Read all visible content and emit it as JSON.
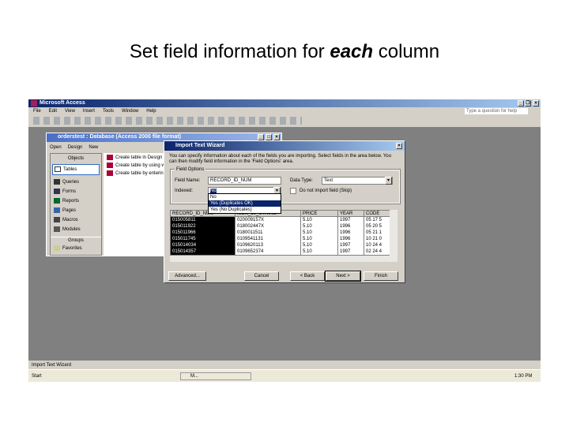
{
  "slide": {
    "title_pre": "Set field information for ",
    "title_em": "each",
    "title_post": " column"
  },
  "access": {
    "title": "Microsoft Access",
    "menu": [
      "File",
      "Edit",
      "View",
      "Insert",
      "Tools",
      "Window",
      "Help"
    ],
    "help_placeholder": "Type a question for help",
    "status": "Import Text Wizard"
  },
  "dbwin": {
    "title": "orderstest : Database (Access 2000 file format)",
    "toolbar": [
      "Open",
      "Design",
      "New"
    ],
    "objects_header": "Objects",
    "objects": [
      "Tables",
      "Queries",
      "Forms",
      "Reports",
      "Pages",
      "Macros",
      "Modules"
    ],
    "groups_header": "Groups",
    "groups": [
      "Favorites"
    ],
    "items": [
      "Create table in Design view",
      "Create table by using wizard",
      "Create table by entering data"
    ]
  },
  "wizard": {
    "title": "Import Text Wizard",
    "intro": "You can specify information about each of the fields you are importing. Select fields in the area below. You can then modify field information in the 'Field Options' area.",
    "group": "Field Options",
    "field_name_label": "Field Name:",
    "field_name": "RECORD_ID_NUM",
    "data_type_label": "Data Type:",
    "data_type": "Text",
    "indexed_label": "Indexed:",
    "indexed": "No",
    "indexed_options": [
      "No",
      "Yes (Duplicates OK)",
      "Yes (No Duplicates)"
    ],
    "skip_label": "Do not import field (Skip)",
    "columns": [
      "RECORD_ID_NUM",
      "ISBN_10_STRING",
      "PRICE",
      "YEAR",
      "CODE"
    ],
    "rows": [
      [
        "015005811",
        "020009157X",
        "5.10",
        "1997",
        "05 17 5"
      ],
      [
        "015011922",
        "018002447X",
        "5.10",
        "1996",
        "05 20 5"
      ],
      [
        "015011966",
        "0180011511",
        "5.10",
        "1996",
        "05 21 1"
      ],
      [
        "015011745",
        "0109541131",
        "5.10",
        "1996",
        "10 21 0"
      ],
      [
        "015014034",
        "0109620113",
        "5.10",
        "1997",
        "10 24 4"
      ],
      [
        "015014357",
        "0109652374",
        "5.10",
        "1997",
        "02 24 4"
      ]
    ],
    "buttons": {
      "advanced": "Advanced...",
      "cancel": "Cancel",
      "back": "< Back",
      "next": "Next >",
      "finish": "Finish"
    }
  },
  "taskbar": {
    "start": "Start",
    "task": "M...",
    "clock": "1:30 PM"
  }
}
